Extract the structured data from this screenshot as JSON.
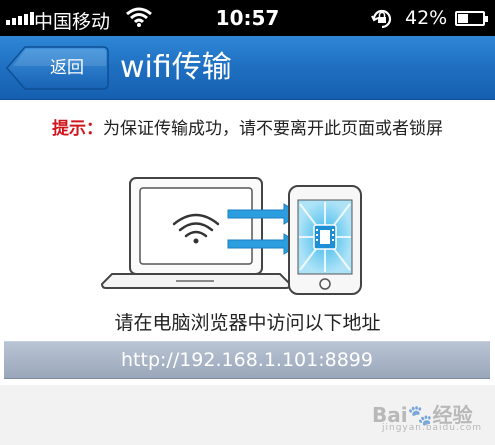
{
  "status_bar": {
    "carrier": "中国移动",
    "time": "10:57",
    "battery_percent": "42%",
    "battery_level": 0.42,
    "icons": [
      "signal-icon",
      "wifi-icon",
      "rotation-lock-icon",
      "battery-icon"
    ]
  },
  "nav": {
    "back_label": "返回",
    "title": "wifi传输"
  },
  "hint": {
    "label": "提示：",
    "text": "为保证传输成功，请不要离开此页面或者锁屏"
  },
  "illustration": {
    "icons": [
      "laptop-icon",
      "wifi-icon",
      "transfer-arrows-icon",
      "phone-icon",
      "video-file-icon"
    ]
  },
  "instruction": "请在电脑浏览器中访问以下地址",
  "address": "http://192.168.1.101:8899",
  "watermark": {
    "text": "Bai",
    "suffix": "经验",
    "sub": "jingyan.baidu.com"
  },
  "colors": {
    "nav_blue": "#1f6fc1",
    "hint_red": "#d0161d",
    "address_bar": "#a9b5c7",
    "phone_screen": "#5cc4ee"
  }
}
